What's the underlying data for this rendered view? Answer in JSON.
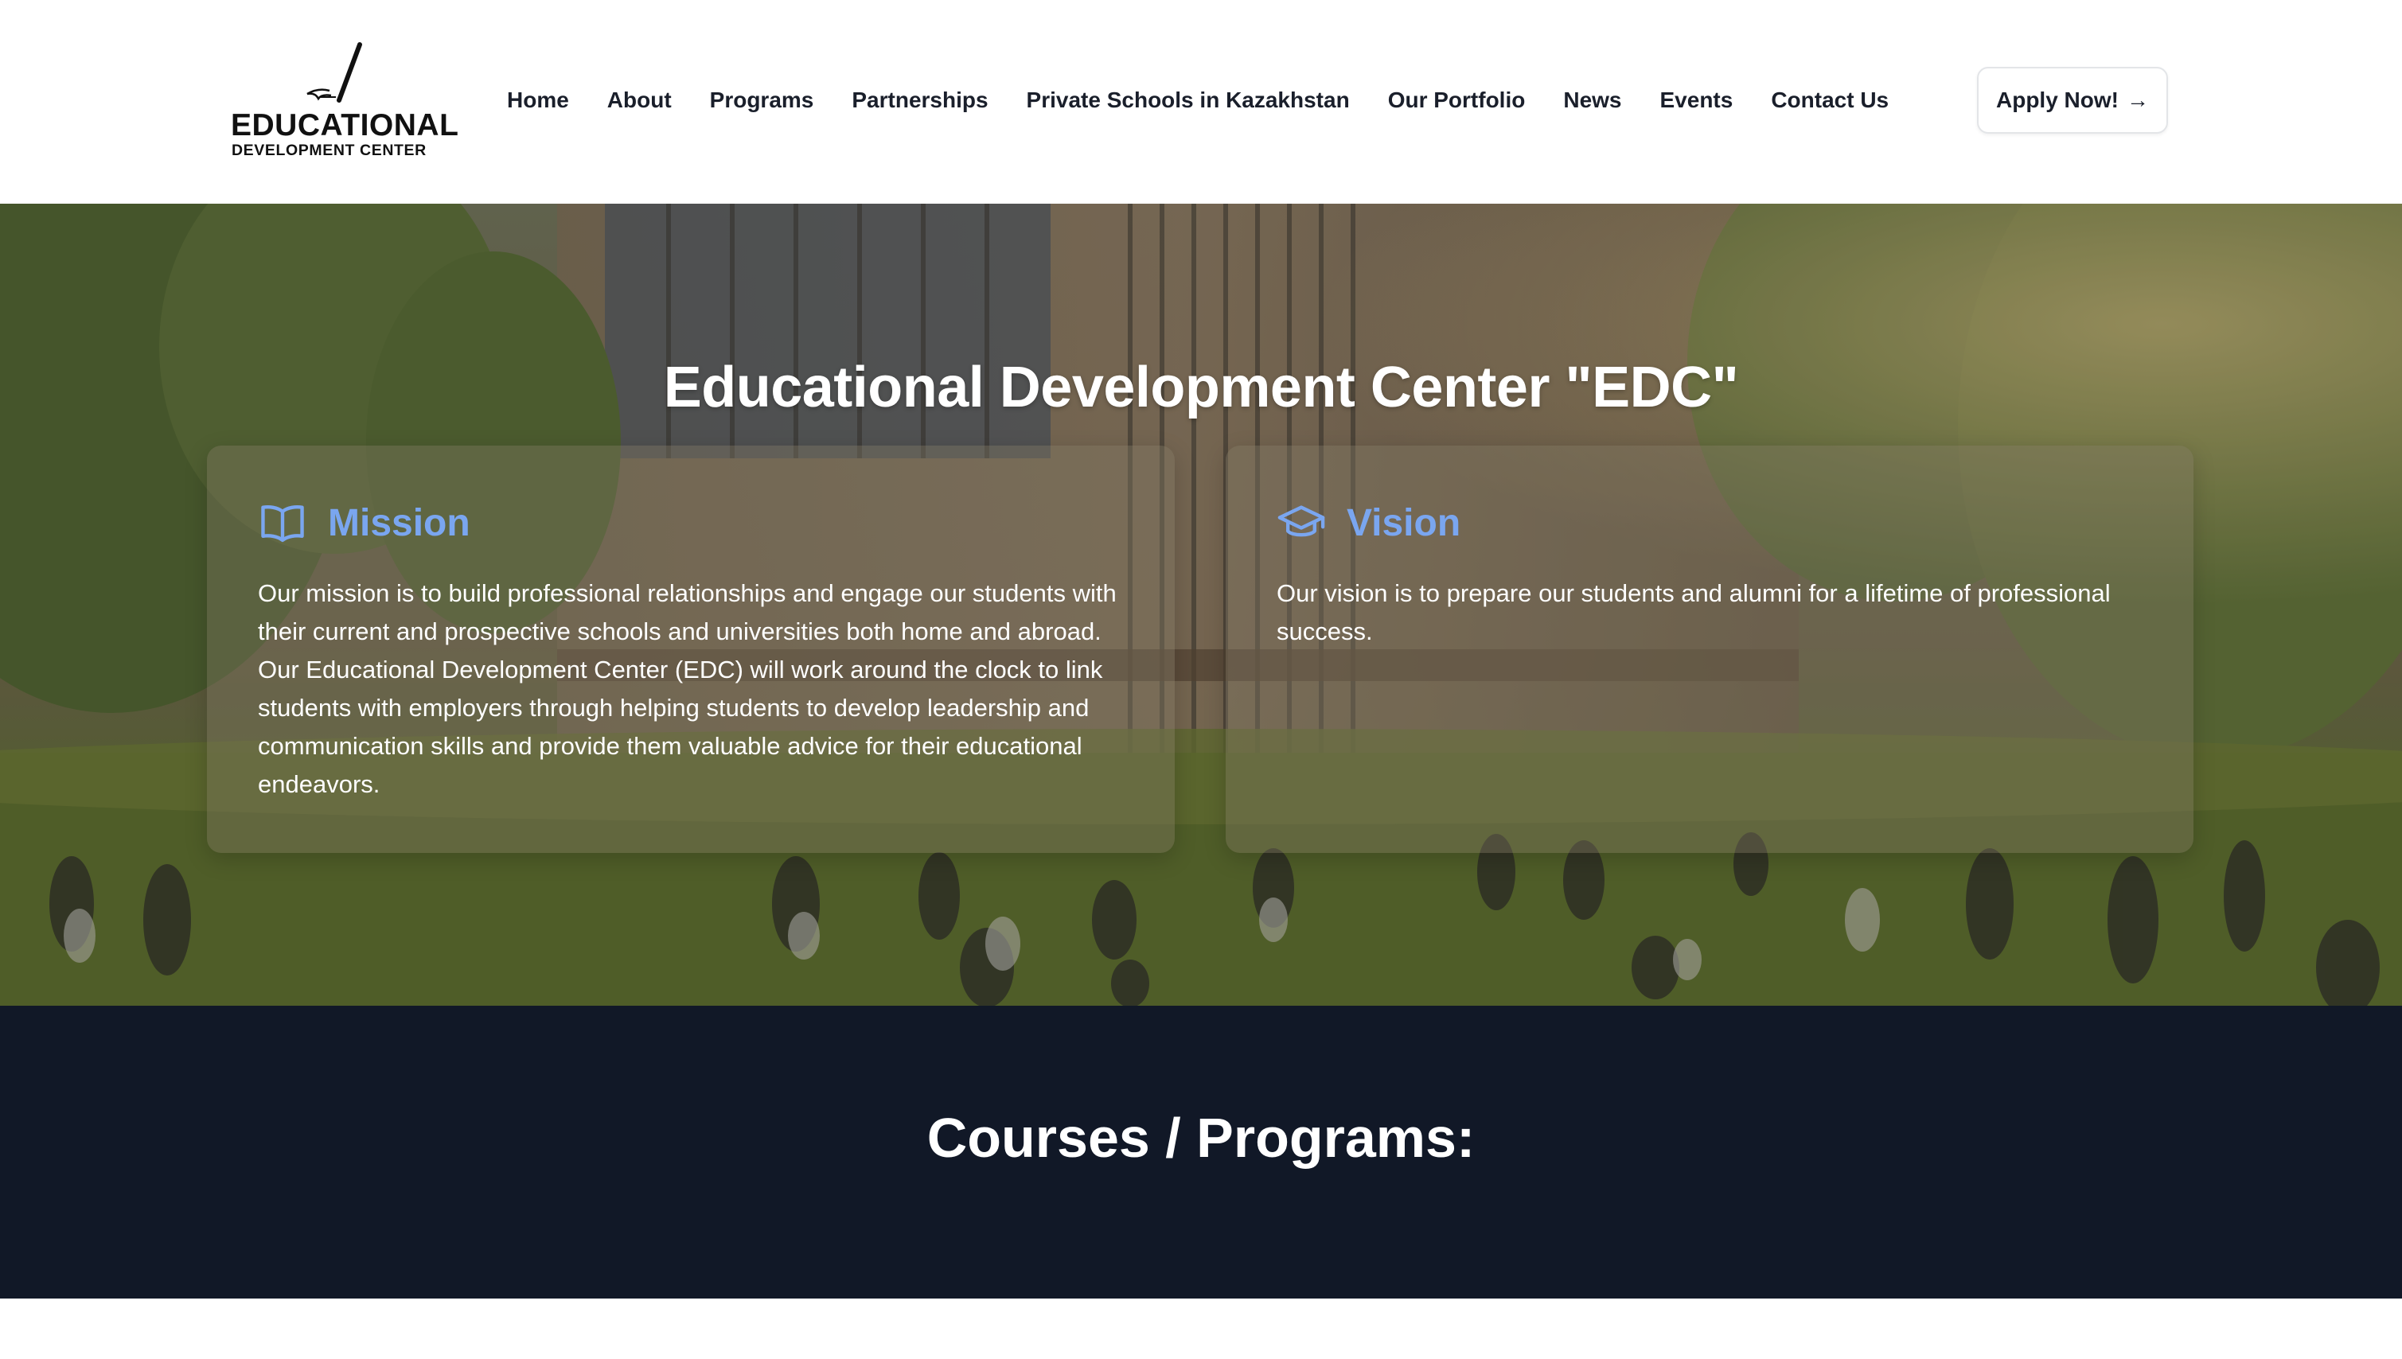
{
  "logo": {
    "line1": "EDUCATIONAL",
    "line2": "DEVELOPMENT CENTER"
  },
  "nav": {
    "items": [
      {
        "label": "Home"
      },
      {
        "label": "About"
      },
      {
        "label": "Programs"
      },
      {
        "label": "Partnerships"
      },
      {
        "label": "Private Schools in Kazakhstan"
      },
      {
        "label": "Our Portfolio"
      },
      {
        "label": "News"
      },
      {
        "label": "Events"
      },
      {
        "label": "Contact Us"
      }
    ]
  },
  "header": {
    "apply_label": "Apply Now!",
    "apply_arrow": "→"
  },
  "hero": {
    "title": "Educational Development Center \"EDC\"",
    "mission": {
      "icon": "open-book-icon",
      "title": "Mission",
      "text": "Our mission is to build professional relationships and engage our students with their current and prospective schools and universities both home and abroad. Our Educational Development Center (EDC) will work around the clock to link students with employers through helping students to develop leadership and communication skills and provide them valuable advice for their educational endeavors."
    },
    "vision": {
      "icon": "graduation-cap-icon",
      "title": "Vision",
      "text": "Our vision is to prepare our students and alumni for a lifetime of professional success."
    }
  },
  "courses": {
    "title": "Courses / Programs:"
  },
  "colors": {
    "accent": "#7aa6f0",
    "dark_section": "#111827",
    "nav_text": "#1a1f2b"
  }
}
